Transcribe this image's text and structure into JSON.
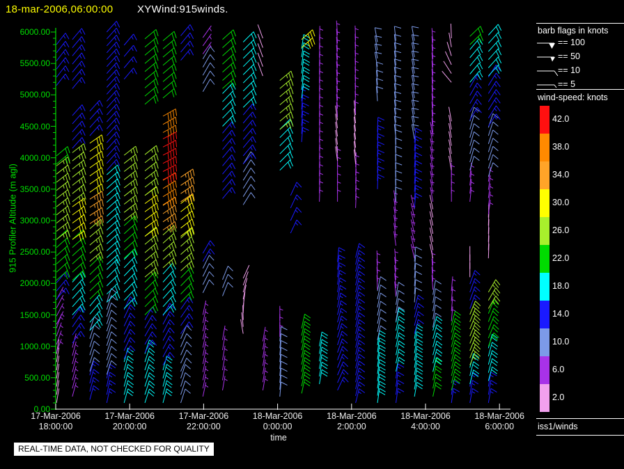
{
  "header": {
    "datetime": "18-mar-2006,06:00:00",
    "datetime_color": "#ffff00",
    "title": "XYWind:915winds."
  },
  "footer": {
    "disclaimer": "REAL-TIME DATA, NOT CHECKED FOR QUALITY",
    "source": "iss1/winds"
  },
  "axes": {
    "y": {
      "label": "915 Profiler Altitude (m agl)",
      "color": "#00e000",
      "ticks": [
        "6000.00",
        "5500.00",
        "5000.00",
        "4500.00",
        "4000.00",
        "3500.00",
        "3000.00",
        "2500.00",
        "2000.00",
        "1500.00",
        "1000.00",
        "500.00",
        "0.00"
      ]
    },
    "x": {
      "label": "time",
      "color": "#ffffff",
      "ticks": [
        {
          "date": "17-Mar-2006",
          "time": "18:00:00"
        },
        {
          "date": "17-Mar-2006",
          "time": "20:00:00"
        },
        {
          "date": "17-Mar-2006",
          "time": "22:00:00"
        },
        {
          "date": "18-Mar-2006",
          "time": "0:00:00"
        },
        {
          "date": "18-Mar-2006",
          "time": "2:00:00"
        },
        {
          "date": "18-Mar-2006",
          "time": "4:00:00"
        },
        {
          "date": "18-Mar-2006",
          "time": "6:00:00"
        }
      ]
    }
  },
  "legend": {
    "barb_title": "barb flags in knots",
    "barb_items": [
      {
        "symbol": "pennant-flag",
        "value": 100,
        "label": "== 100"
      },
      {
        "symbol": "small-flag",
        "value": 50,
        "label": "== 50"
      },
      {
        "symbol": "full-barb",
        "value": 10,
        "label": "== 10"
      },
      {
        "symbol": "half-barb",
        "value": 5,
        "label": "== 5"
      }
    ],
    "speed_title": "wind-speed: knots",
    "colorbar": [
      {
        "label": "42.0",
        "color": "#ff1010"
      },
      {
        "label": "38.0",
        "color": "#ff8a00"
      },
      {
        "label": "34.0",
        "color": "#ffa428"
      },
      {
        "label": "30.0",
        "color": "#ffff00"
      },
      {
        "label": "26.0",
        "color": "#a8f02c"
      },
      {
        "label": "22.0",
        "color": "#00dc00"
      },
      {
        "label": "18.0",
        "color": "#00ffff"
      },
      {
        "label": "14.0",
        "color": "#1a1aff"
      },
      {
        "label": "10.0",
        "color": "#7c9ae8"
      },
      {
        "label": "6.0",
        "color": "#a832e8"
      },
      {
        "label": "2.0",
        "color": "#f2a0ee"
      }
    ]
  },
  "chart_data": {
    "type": "wind-barb-time-height",
    "title": "XYWind:915winds.",
    "xlabel": "time",
    "ylabel": "915 Profiler Altitude (m agl)",
    "ylim": [
      0,
      6000
    ],
    "y_major_tick_step_m": 500,
    "y_minor_tick_step_m": 100,
    "x_hours_since_17mar_0000": [
      17.7,
      30.3
    ],
    "x_major_tick_hours": [
      18,
      20,
      22,
      24,
      26,
      28,
      30
    ],
    "speed_colors": [
      {
        "value": 2,
        "color": "#f2a0ee"
      },
      {
        "value": 6,
        "color": "#a832e8"
      },
      {
        "value": 10,
        "color": "#7c9ae8"
      },
      {
        "value": 14,
        "color": "#1a1aff"
      },
      {
        "value": 18,
        "color": "#00ffff"
      },
      {
        "value": 22,
        "color": "#00dc00"
      },
      {
        "value": 26,
        "color": "#a8f02c"
      },
      {
        "value": 30,
        "color": "#ffff00"
      },
      {
        "value": 34,
        "color": "#ffa428"
      },
      {
        "value": 38,
        "color": "#ff8a00"
      },
      {
        "value": 42,
        "color": "#ff1010"
      }
    ],
    "profile_segment_fields": [
      "alt_min_m",
      "alt_max_m",
      "speed_knots",
      "dir_from_deg",
      "dir_to_deg_optional",
      "alt_step_m_optional"
    ],
    "default_alt_step_m": 130,
    "profiles": [
      {
        "h": 18.02,
        "seg": [
          [
            100,
            900,
            2,
            10
          ],
          [
            900,
            1350,
            6,
            20
          ],
          [
            1350,
            1750,
            6,
            28
          ],
          [
            1750,
            2050,
            14,
            40
          ],
          [
            2050,
            2700,
            22,
            48
          ],
          [
            2700,
            3900,
            26,
            52
          ],
          [
            3900,
            4100,
            22,
            50
          ],
          [
            5150,
            5850,
            14,
            38
          ]
        ]
      },
      {
        "h": 18.45,
        "seg": [
          [
            200,
            1050,
            6,
            15
          ],
          [
            1050,
            1500,
            14,
            35
          ],
          [
            1500,
            2050,
            18,
            42
          ],
          [
            2050,
            2700,
            22,
            48
          ],
          [
            2700,
            3300,
            30,
            54
          ],
          [
            3300,
            4100,
            26,
            52
          ],
          [
            4150,
            4730,
            14,
            42
          ],
          [
            5100,
            5900,
            14,
            40
          ]
        ]
      },
      {
        "h": 18.92,
        "seg": [
          [
            150,
            600,
            14,
            15
          ],
          [
            600,
            1250,
            10,
            18
          ],
          [
            1250,
            1750,
            18,
            40
          ],
          [
            1750,
            2350,
            22,
            46
          ],
          [
            2350,
            2950,
            26,
            50
          ],
          [
            2950,
            3450,
            34,
            57
          ],
          [
            3450,
            4350,
            30,
            55
          ],
          [
            4350,
            4800,
            14,
            42
          ]
        ]
      },
      {
        "h": 19.38,
        "seg": [
          [
            100,
            550,
            14,
            12
          ],
          [
            550,
            1700,
            10,
            18,
            18,
            115
          ],
          [
            1700,
            2300,
            18,
            45
          ],
          [
            2300,
            3800,
            18,
            48,
            48,
            110
          ],
          [
            3800,
            6000,
            14,
            42,
            42,
            110
          ]
        ]
      },
      {
        "h": 19.85,
        "seg": [
          [
            100,
            800,
            18,
            15
          ],
          [
            800,
            1600,
            14,
            25
          ],
          [
            1600,
            2400,
            18,
            44
          ],
          [
            2400,
            3000,
            22,
            48
          ],
          [
            3000,
            4050,
            26,
            52
          ],
          [
            5250,
            5800,
            14,
            40,
            40,
            180
          ]
        ]
      },
      {
        "h": 20.41,
        "seg": [
          [
            100,
            900,
            18,
            18
          ],
          [
            900,
            1500,
            14,
            30
          ],
          [
            1500,
            2100,
            22,
            45
          ],
          [
            2100,
            2750,
            26,
            50
          ],
          [
            2750,
            3400,
            30,
            54
          ],
          [
            3400,
            4050,
            26,
            52
          ],
          [
            4850,
            5950,
            22,
            50
          ]
        ]
      },
      {
        "h": 20.9,
        "seg": [
          [
            100,
            700,
            18,
            15
          ],
          [
            700,
            1500,
            14,
            28
          ],
          [
            1500,
            2250,
            18,
            42
          ],
          [
            2250,
            2850,
            26,
            48
          ],
          [
            2850,
            3250,
            34,
            55
          ],
          [
            3250,
            3650,
            38,
            58
          ],
          [
            3650,
            4400,
            42,
            62
          ],
          [
            4400,
            4750,
            38,
            60
          ],
          [
            4950,
            5950,
            22,
            50
          ]
        ]
      },
      {
        "h": 21.38,
        "seg": [
          [
            100,
            600,
            10,
            18
          ],
          [
            600,
            1200,
            10,
            24
          ],
          [
            1200,
            1700,
            14,
            35
          ],
          [
            1700,
            2200,
            22,
            44
          ],
          [
            2200,
            2750,
            26,
            48
          ],
          [
            2750,
            3300,
            30,
            52
          ],
          [
            3300,
            3800,
            34,
            56
          ],
          [
            5550,
            5950,
            14,
            40
          ]
        ]
      },
      {
        "h": 21.98,
        "seg": [
          [
            200,
            1500,
            6,
            12
          ],
          [
            1850,
            2350,
            10,
            26
          ],
          [
            2350,
            2600,
            14,
            30
          ],
          [
            5050,
            5650,
            10,
            30
          ],
          [
            5650,
            6000,
            6,
            35
          ]
        ]
      },
      {
        "h": 22.51,
        "seg": [
          [
            300,
            1200,
            6,
            10,
            10,
            160
          ],
          [
            1800,
            2150,
            10,
            22
          ],
          [
            3350,
            4500,
            14,
            40
          ],
          [
            4500,
            5100,
            18,
            44
          ],
          [
            5100,
            6000,
            22,
            48
          ]
        ]
      },
      {
        "h": 23.07,
        "seg": [
          [
            1200,
            2100,
            2,
            350,
            385,
            110
          ],
          [
            3250,
            3900,
            10,
            32
          ],
          [
            3900,
            4800,
            14,
            40
          ],
          [
            4800,
            5950,
            18,
            45
          ]
        ]
      },
      {
        "h": 23.6,
        "seg": [
          [
            300,
            1100,
            6,
            10
          ],
          [
            5300,
            5900,
            2,
            340,
            340,
            150
          ]
        ]
      },
      {
        "h": 24.06,
        "seg": [
          [
            200,
            1150,
            10,
            5,
            5,
            110
          ],
          [
            1150,
            1500,
            6,
            0
          ],
          [
            3800,
            4450,
            18,
            45
          ],
          [
            4450,
            5250,
            26,
            50
          ]
        ]
      },
      {
        "h": 24.35,
        "seg": [
          [
            2800,
            3450,
            14,
            25,
            25,
            200
          ]
        ]
      },
      {
        "h": 24.65,
        "seg": [
          [
            250,
            1350,
            22,
            12,
            12,
            115
          ],
          [
            4250,
            4950,
            14,
            4
          ],
          [
            4950,
            5750,
            18,
            8
          ],
          [
            5750,
            5950,
            30,
            48
          ]
        ]
      },
      {
        "h": 25.13,
        "seg": [
          [
            400,
            1050,
            18,
            10,
            10,
            120
          ],
          [
            3300,
            5950,
            6,
            2,
            2,
            135
          ]
        ]
      },
      {
        "h": 25.62,
        "seg": [
          [
            300,
            2350,
            14,
            25,
            5,
            120
          ],
          [
            3300,
            3950,
            6,
            0
          ],
          [
            3950,
            4650,
            2,
            352
          ],
          [
            4650,
            5950,
            6,
            356
          ]
        ]
      },
      {
        "h": 26.11,
        "seg": [
          [
            100,
            2450,
            14,
            14,
            14,
            110
          ],
          [
            3200,
            3900,
            6,
            2
          ],
          [
            3900,
            4700,
            2,
            354
          ],
          [
            4700,
            5900,
            6,
            358
          ]
        ]
      },
      {
        "h": 26.7,
        "seg": [
          [
            100,
            1100,
            18,
            8,
            8,
            115
          ],
          [
            1100,
            1900,
            10,
            12
          ],
          [
            1900,
            2400,
            6,
            358
          ],
          [
            3500,
            4450,
            14,
            2
          ],
          [
            4900,
            5300,
            10,
            356
          ],
          [
            5450,
            5900,
            10,
            350
          ]
        ]
      },
      {
        "h": 27.2,
        "seg": [
          [
            100,
            600,
            14,
            8
          ],
          [
            600,
            1400,
            18,
            12
          ],
          [
            1400,
            1800,
            10,
            10
          ],
          [
            1800,
            2400,
            6,
            355
          ],
          [
            2600,
            3300,
            6,
            352
          ],
          [
            3300,
            4300,
            10,
            358
          ],
          [
            4300,
            5900,
            10,
            354
          ]
        ]
      },
      {
        "h": 27.7,
        "seg": [
          [
            200,
            1200,
            18,
            10,
            10,
            115
          ],
          [
            1200,
            1700,
            14,
            15
          ],
          [
            1700,
            2400,
            10,
            5
          ],
          [
            2400,
            3200,
            6,
            347
          ],
          [
            3200,
            4300,
            14,
            5
          ],
          [
            4300,
            5900,
            10,
            350
          ]
        ]
      },
      {
        "h": 28.2,
        "seg": [
          [
            200,
            600,
            22,
            12
          ],
          [
            600,
            1300,
            18,
            15
          ],
          [
            1300,
            1900,
            10,
            10
          ],
          [
            1900,
            2400,
            6,
            356
          ],
          [
            2400,
            3300,
            2,
            348
          ],
          [
            3300,
            4400,
            6,
            350
          ],
          [
            4400,
            5900,
            6,
            356
          ]
        ]
      },
      {
        "h": 28.7,
        "seg": [
          [
            100,
            300,
            14,
            8
          ],
          [
            300,
            1400,
            22,
            15,
            15,
            115
          ],
          [
            1400,
            2000,
            6,
            5,
            5,
            160
          ],
          [
            3300,
            3800,
            6,
            0
          ],
          [
            3800,
            4700,
            2,
            350
          ],
          [
            5200,
            5900,
            2,
            320,
            358,
            140
          ]
        ]
      },
      {
        "h": 29.2,
        "seg": [
          [
            100,
            400,
            14,
            10
          ],
          [
            400,
            700,
            18,
            14
          ],
          [
            700,
            1600,
            26,
            22,
            22,
            115
          ],
          [
            1600,
            2100,
            14,
            20
          ],
          [
            2100,
            2400,
            2,
            0
          ],
          [
            3300,
            3800,
            6,
            6
          ],
          [
            3800,
            4600,
            10,
            16
          ],
          [
            4600,
            5200,
            14,
            30
          ],
          [
            5200,
            5800,
            18,
            40
          ],
          [
            5800,
            6000,
            22,
            46
          ]
        ]
      },
      {
        "h": 29.7,
        "seg": [
          [
            100,
            450,
            14,
            10
          ],
          [
            450,
            1000,
            18,
            15
          ],
          [
            1000,
            1600,
            22,
            22
          ],
          [
            1600,
            1950,
            26,
            30
          ],
          [
            2400,
            3100,
            2,
            2
          ],
          [
            3100,
            3700,
            6,
            8
          ],
          [
            3700,
            4500,
            10,
            18
          ],
          [
            4500,
            5300,
            14,
            32
          ],
          [
            5300,
            6000,
            18,
            42
          ]
        ]
      }
    ]
  }
}
